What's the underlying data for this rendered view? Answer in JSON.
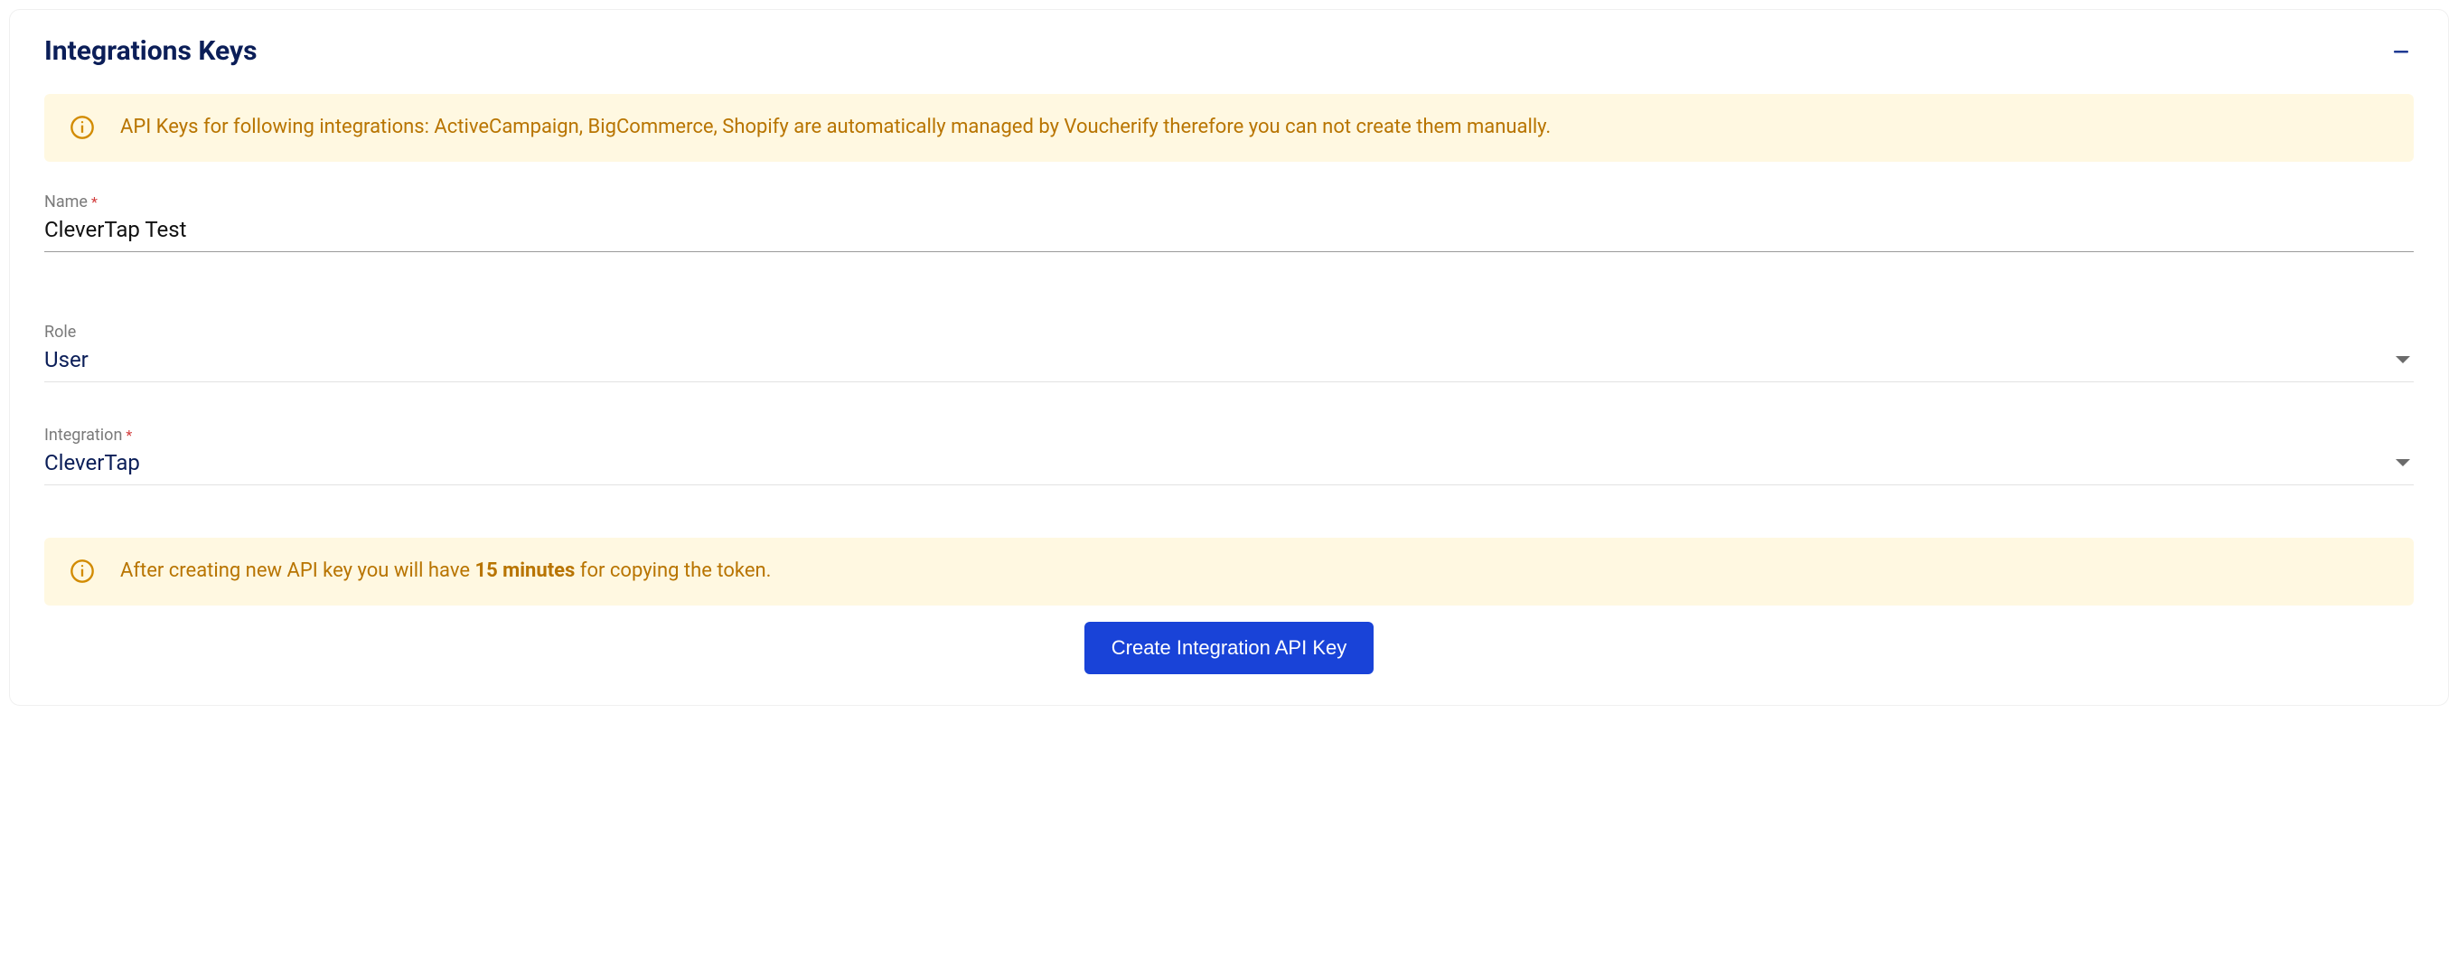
{
  "header": {
    "title": "Integrations Keys"
  },
  "alerts": {
    "managed": "API Keys for following integrations: ActiveCampaign, BigCommerce, Shopify are automatically managed by Voucherify therefore you can not create them manually.",
    "afterCreate_prefix": "After creating new API key you will have ",
    "afterCreate_bold": "15 minutes",
    "afterCreate_suffix": " for copying the token."
  },
  "fields": {
    "name": {
      "label": "Name",
      "value": "CleverTap Test"
    },
    "role": {
      "label": "Role",
      "value": "User"
    },
    "integration": {
      "label": "Integration",
      "value": "CleverTap"
    }
  },
  "buttons": {
    "create": "Create Integration API Key"
  }
}
